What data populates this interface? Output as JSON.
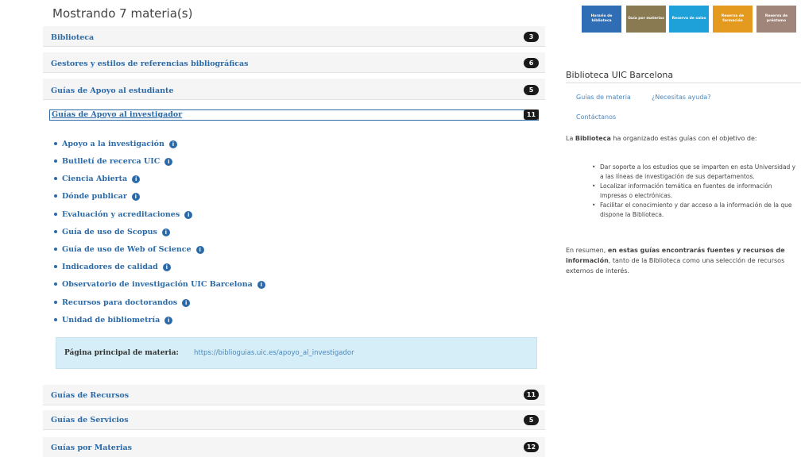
{
  "list": {
    "count_text": "Mostrando 7 materia(s)",
    "rows_top": [
      {
        "label": "Biblioteca",
        "count": "3"
      },
      {
        "label": "Gestores y estilos de referencias bibliográficas",
        "count": "6"
      },
      {
        "label": "Guías de Apoyo al estudiante",
        "count": "5"
      }
    ],
    "open": {
      "label": "Guías de Apoyo al investigador",
      "count": "11",
      "items": [
        "Apoyo a la investigación",
        "Butlletí de recerca UIC",
        "Ciencia Abierta",
        "Dónde publicar",
        "Evaluación y acreditaciones",
        "Guía de uso de Scopus",
        "Guía de uso de Web of Science",
        "Indicadores de calidad",
        "Observatorio de investigación UIC Barcelona",
        "Recursos para doctorandos",
        "Unidad de bibliometría"
      ],
      "main_page_label": "Página principal de materia:",
      "main_page_url": "https://biblioguias.uic.es/apoyo_al_investigador"
    },
    "rows_bottom": [
      {
        "label": "Guías de Recursos",
        "count": "11"
      },
      {
        "label": "Guías de Servicios",
        "count": "5"
      },
      {
        "label": "Guías por Materias",
        "count": "12"
      }
    ]
  },
  "tiles": [
    {
      "label": "Horario de biblioteca",
      "color": "#2f6db5"
    },
    {
      "label": "Guía por materias",
      "color": "#8a7a52"
    },
    {
      "label": "Reserva de salas",
      "color": "#1ea0d8"
    },
    {
      "label": "Reserva de formación",
      "color": "#e39a1e"
    },
    {
      "label": "Reserva de préstamo",
      "color": "#a0857a"
    }
  ],
  "sidebar": {
    "title": "Biblioteca UIC Barcelona",
    "links": [
      "Guías de materia",
      "¿Necesitas ayuda?",
      "Contáctanos"
    ],
    "intro_bold": "Biblioteca",
    "intro_pre": "La ",
    "intro_post": " ha organizado estas guías con el objetivo de:",
    "bullets": [
      "Dar soporte a los estudios que se imparten en esta Universidad y a las líneas de investigación de sus departamentos.",
      "Localizar información temática en fuentes de información impresas o electrónicas.",
      "Facilitar el conocimiento y dar acceso a la información de la que dispone la Biblioteca."
    ],
    "summary_pre": "En resumen, ",
    "summary_bold": "en estas guías encontrarás fuentes y recursos de información",
    "summary_post": ", tanto de la Biblioteca como una selección de recursos externos de interés."
  },
  "colors": {
    "link": "#2b6aa8",
    "badge": "#1a1a1a",
    "highlight": "#d6eef7"
  },
  "icons": {
    "info": "info-icon"
  }
}
